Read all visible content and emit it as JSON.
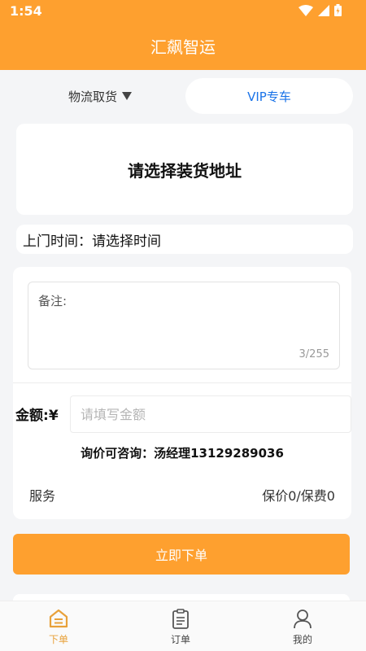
{
  "status_bar": {
    "time": "1:54"
  },
  "app": {
    "title": "汇飙智运"
  },
  "mode_tabs": {
    "left_label": "物流取货",
    "right_label": "VIP专车"
  },
  "address": {
    "prompt": "请选择装货地址"
  },
  "pickup_time": {
    "label": "上门时间：",
    "value": "请选择时间"
  },
  "remark": {
    "label": "备注:",
    "count": "3/255"
  },
  "amount": {
    "label": "金额:",
    "currency": "¥",
    "placeholder": "请填写金额"
  },
  "inquiry": {
    "text": "询价可咨询：汤经理13129289036"
  },
  "service": {
    "label": "服务",
    "value": "保价0/保费0"
  },
  "order_button": {
    "label": "立即下单"
  },
  "tabbar": {
    "items": [
      {
        "label": "下单",
        "icon": "home-order-icon",
        "active": true
      },
      {
        "label": "订单",
        "icon": "clipboard-icon",
        "active": false
      },
      {
        "label": "我的",
        "icon": "user-icon",
        "active": false
      }
    ]
  },
  "colors": {
    "accent": "#fea02f",
    "link": "#1a73e8",
    "active_tab": "#e8a13a"
  }
}
